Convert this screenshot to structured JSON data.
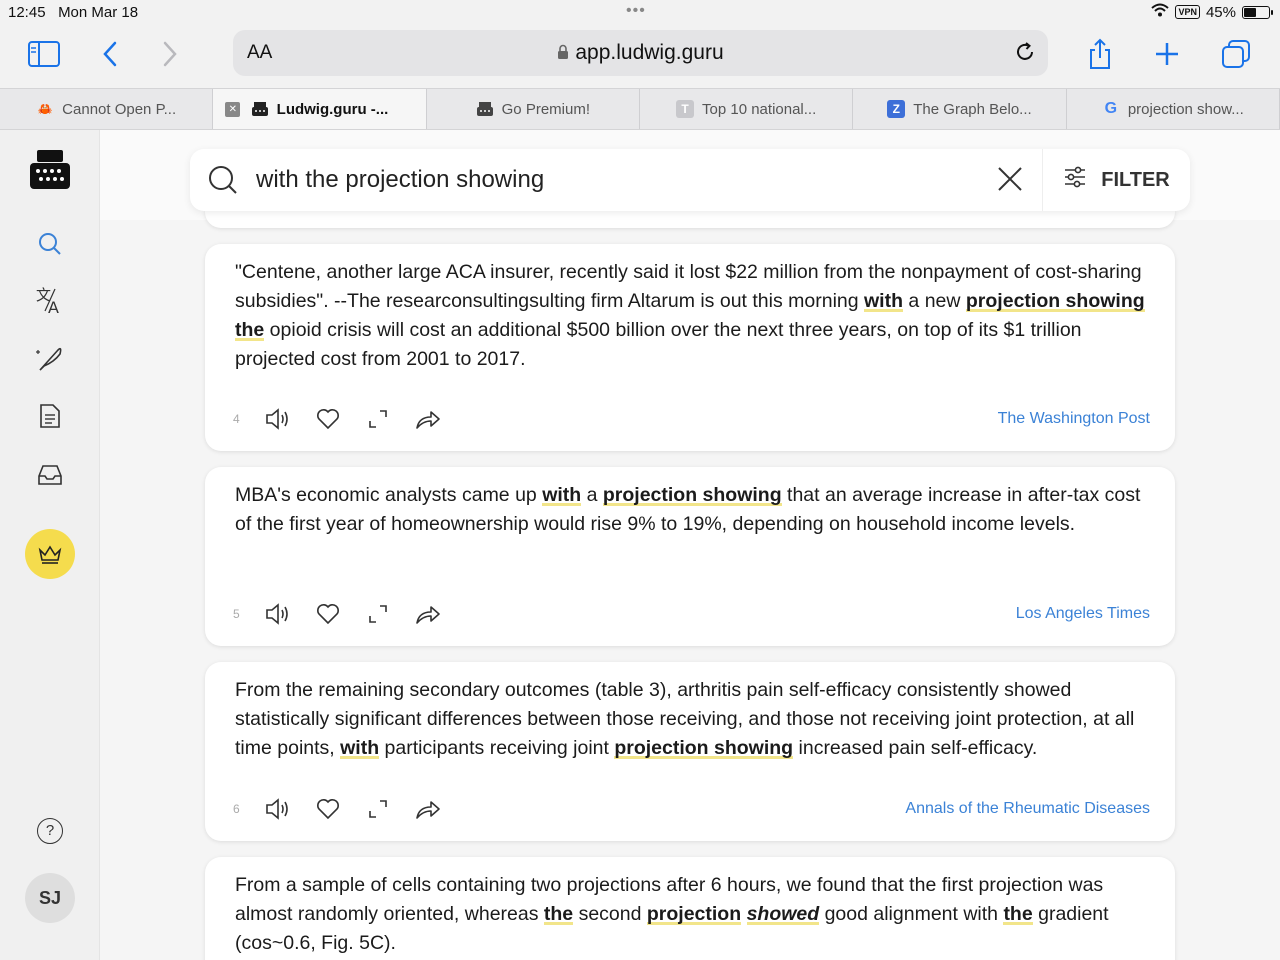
{
  "status": {
    "time": "12:45",
    "date": "Mon Mar 18",
    "vpn": "VPN",
    "battery": "45%",
    "battery_level": 0.45
  },
  "toolbar": {
    "aa": "AA",
    "url": "app.ludwig.guru"
  },
  "tabs": [
    {
      "label": "Cannot Open P...",
      "icon": "crab-icon",
      "active": false
    },
    {
      "label": "Ludwig.guru -...",
      "icon": "typewriter-icon",
      "active": true
    },
    {
      "label": "Go Premium!",
      "icon": "typewriter-icon",
      "active": false
    },
    {
      "label": "Top 10 national...",
      "icon": "t-icon",
      "active": false
    },
    {
      "label": "The Graph Belo...",
      "icon": "z-icon",
      "active": false
    },
    {
      "label": "projection show...",
      "icon": "google-icon",
      "active": false
    }
  ],
  "sidebar": {
    "avatar": "SJ",
    "help": "?"
  },
  "search": {
    "query": "with the projection showing",
    "filter_label": "FILTER"
  },
  "cards": [
    {
      "number": "4",
      "source": "The Washington Post",
      "segments": [
        {
          "t": "\"Centene, another large ACA insurer, recently said it lost $22 million from the nonpayment of cost-sharing subsidies\". --The researconsultingsulting firm Altarum is out this morning "
        },
        {
          "t": "with",
          "hl": true
        },
        {
          "t": " a new "
        },
        {
          "t": "projection showing the",
          "hl": true
        },
        {
          "t": " opioid crisis will cost an additional $500 billion over the next three years, on top of its $1 trillion projected cost from 2001 to 2017."
        }
      ]
    },
    {
      "number": "5",
      "source": "Los Angeles Times",
      "segments": [
        {
          "t": "MBA's economic analysts came up "
        },
        {
          "t": "with",
          "hl": true
        },
        {
          "t": " a "
        },
        {
          "t": "projection showing",
          "hl": true
        },
        {
          "t": " that an average increase in after-tax cost of the first year of homeownership would rise 9% to 19%, depending on household income levels."
        }
      ]
    },
    {
      "number": "6",
      "source": "Annals of the Rheumatic Diseases",
      "segments": [
        {
          "t": "From the remaining secondary outcomes (table 3), arthritis pain self-efficacy consistently showed statistically significant differences between those receiving, and those not receiving joint protection, at all time points, "
        },
        {
          "t": "with",
          "hl": true
        },
        {
          "t": " participants receiving joint "
        },
        {
          "t": "projection showing",
          "hl": true
        },
        {
          "t": " increased pain self-efficacy."
        }
      ]
    },
    {
      "number": "",
      "source": "",
      "segments": [
        {
          "t": "From a sample of cells containing two projections after 6 hours, we found that the first projection was almost randomly oriented, whereas "
        },
        {
          "t": "the",
          "hl": true
        },
        {
          "t": " second "
        },
        {
          "t": "projection",
          "hl": true
        },
        {
          "t": " "
        },
        {
          "t": "showed",
          "hl": true,
          "italic": true
        },
        {
          "t": " good alignment with "
        },
        {
          "t": "the",
          "hl": true
        },
        {
          "t": " gradient (cos~0.6, Fig. 5C)."
        }
      ]
    }
  ]
}
